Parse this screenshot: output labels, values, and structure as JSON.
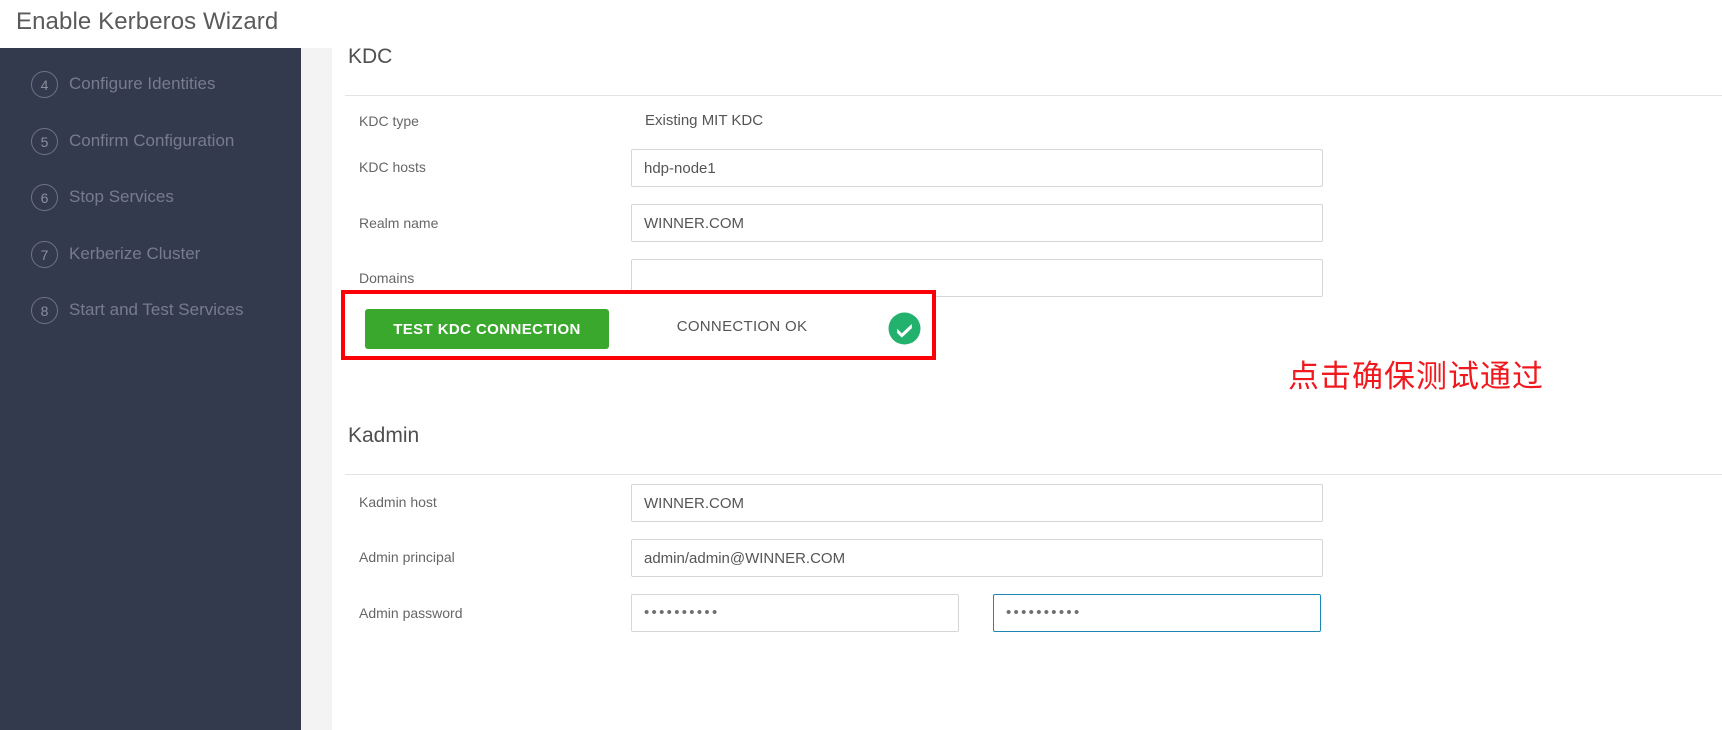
{
  "header": {
    "title": "Enable Kerberos Wizard"
  },
  "sidebar": {
    "steps": [
      {
        "number": "4",
        "label": "Configure Identities"
      },
      {
        "number": "5",
        "label": "Confirm Configuration"
      },
      {
        "number": "6",
        "label": "Stop Services"
      },
      {
        "number": "7",
        "label": "Kerberize Cluster"
      },
      {
        "number": "8",
        "label": "Start and Test Services"
      }
    ]
  },
  "sections": {
    "kdc": {
      "title": "KDC",
      "fields": {
        "kdc_type": {
          "label": "KDC type",
          "value": "Existing MIT KDC"
        },
        "kdc_hosts": {
          "label": "KDC hosts",
          "value": "hdp-node1",
          "placeholder": ""
        },
        "realm_name": {
          "label": "Realm name",
          "value": "WINNER.COM",
          "placeholder": ""
        },
        "domains": {
          "label": "Domains",
          "value": "",
          "placeholder": ""
        }
      },
      "test": {
        "button_label": "TEST KDC CONNECTION",
        "status_text": "CONNECTION OK",
        "status_icon": "check-circle-icon",
        "button_color": "#3aa82d",
        "status_color": "#23b26d",
        "highlight_color": "#fb0007"
      }
    },
    "kadmin": {
      "title": "Kadmin",
      "fields": {
        "kadmin_host": {
          "label": "Kadmin host",
          "value": "WINNER.COM",
          "placeholder": ""
        },
        "admin_principal": {
          "label": "Admin principal",
          "value": "admin/admin@WINNER.COM",
          "placeholder": ""
        },
        "admin_password": {
          "label": "Admin password",
          "value_masked": "••••••••••",
          "confirm_masked": "••••••••••"
        }
      }
    }
  },
  "annotation": {
    "text": "点击确保测试通过",
    "color": "#f0191e"
  }
}
